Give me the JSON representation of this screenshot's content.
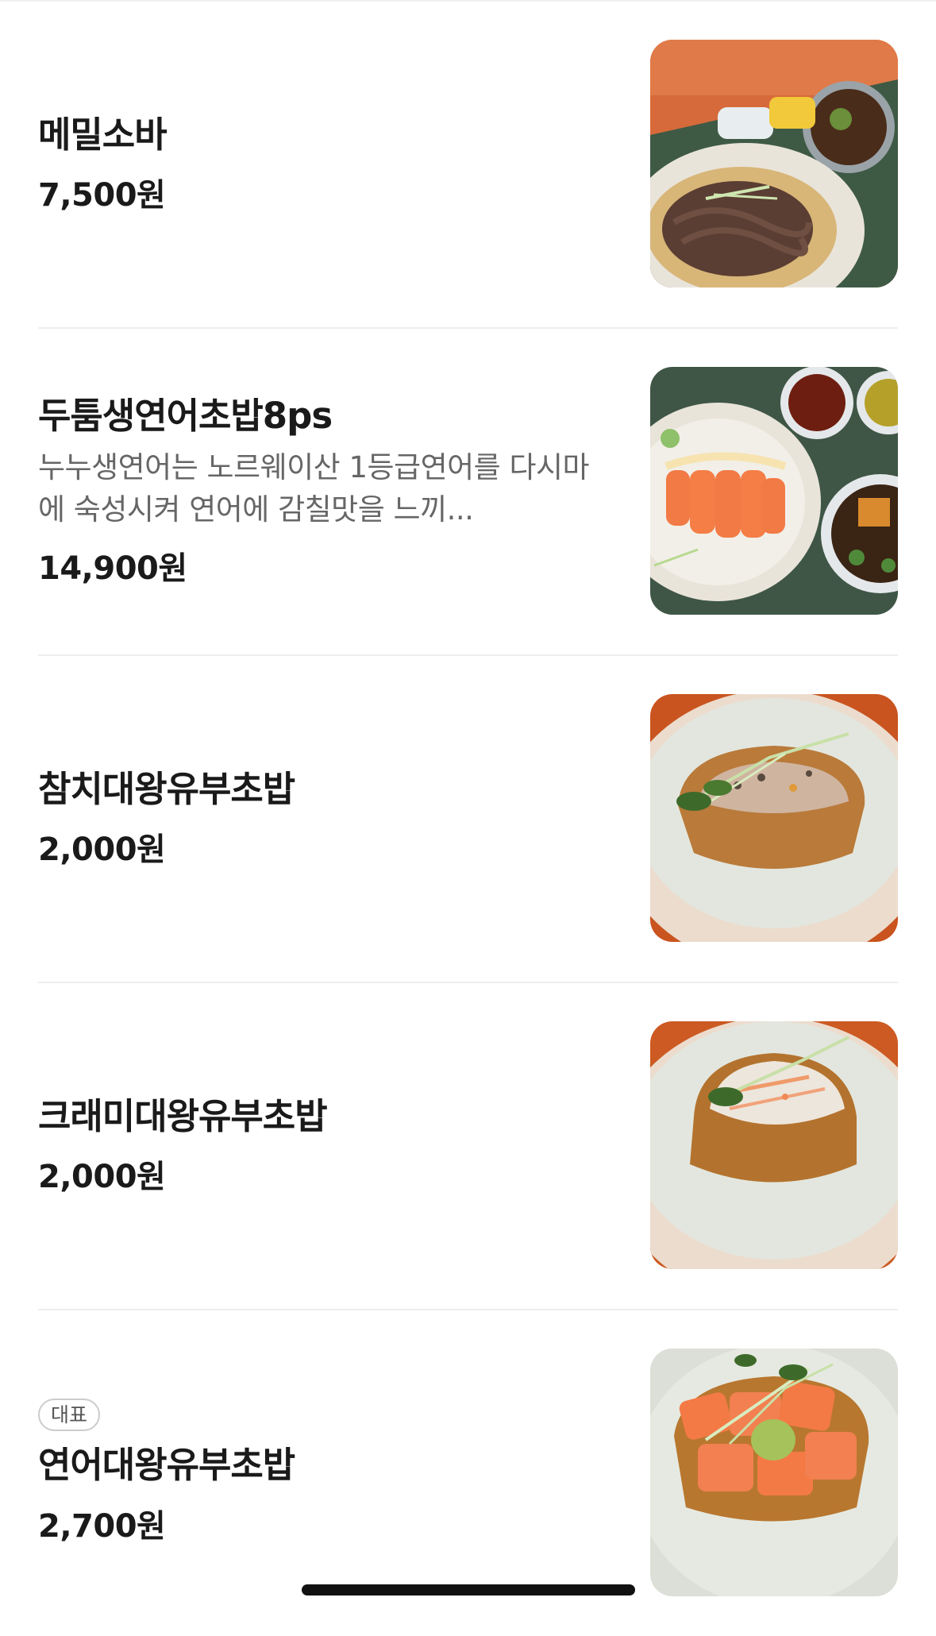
{
  "menu": {
    "items": [
      {
        "name": "메밀소바",
        "price": "7,500원",
        "image": "soba-photo"
      },
      {
        "name": "두툼생연어초밥8ps",
        "description": "누누생연어는 노르웨이산 1등급연어를 다시마에 숙성시켜 연어에 감칠맛을 느끼...",
        "price": "14,900원",
        "image": "salmon-sushi-photo"
      },
      {
        "name": "참치대왕유부초밥",
        "price": "2,000원",
        "image": "tuna-inari-photo"
      },
      {
        "name": "크래미대왕유부초밥",
        "price": "2,000원",
        "image": "crab-inari-photo"
      },
      {
        "badge": "대표",
        "name": "연어대왕유부초밥",
        "price": "2,700원",
        "image": "salmon-inari-photo"
      }
    ]
  }
}
